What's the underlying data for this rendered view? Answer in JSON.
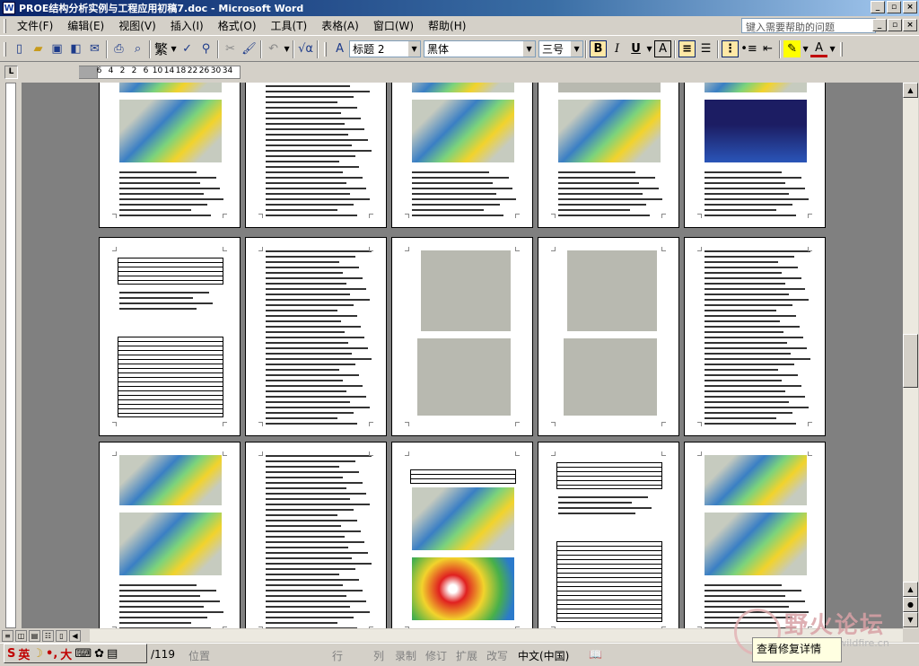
{
  "window": {
    "title": "PROE结构分析实例与工程应用初稿7.doc - Microsoft Word",
    "controls": {
      "minimize": "_",
      "restore": "▫",
      "close": "×"
    }
  },
  "menu": {
    "items": [
      "文件(F)",
      "编辑(E)",
      "视图(V)",
      "插入(I)",
      "格式(O)",
      "工具(T)",
      "表格(A)",
      "窗口(W)",
      "帮助(H)"
    ],
    "help_placeholder": "键入需要帮助的问题",
    "doc_controls": {
      "minimize": "_",
      "restore": "▫",
      "close": "×"
    }
  },
  "toolbar": {
    "traditional": "繁",
    "style_value": "标题 2",
    "font_value": "黑体",
    "size_value": "三号",
    "bold": "B",
    "italic": "I",
    "underline": "U",
    "char_border": "A",
    "font_color_label": "A"
  },
  "ruler": {
    "numbers": [
      "6",
      "4",
      "2",
      "2",
      "6",
      "10",
      "14",
      "18",
      "22",
      "26",
      "30",
      "34"
    ]
  },
  "statusbar": {
    "page_total": "/119",
    "position_label": "位置",
    "line_label": "行",
    "col_label": "列",
    "rec": "录制",
    "trk": "修订",
    "ext": "扩展",
    "ovr": "改写",
    "language": "中文(中国)"
  },
  "ime": {
    "mode": "英",
    "full_half": "大"
  },
  "watermark": {
    "title": "野火论坛",
    "url": "www.proewildfire.cn"
  },
  "tooltip": {
    "repair": "查看修复详情"
  },
  "colors": {
    "title_bar": "#0a246a",
    "workspace": "#808080",
    "chrome": "#d4d0c8"
  }
}
